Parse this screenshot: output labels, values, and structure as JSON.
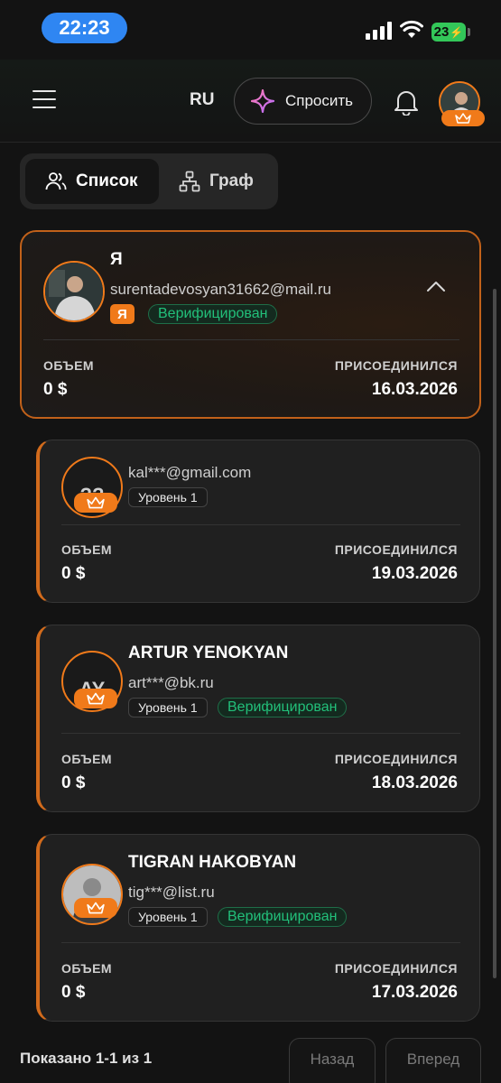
{
  "status_bar": {
    "time": "22:23",
    "battery": "23"
  },
  "header": {
    "lang": "RU",
    "ask_label": "Спросить"
  },
  "tabs": [
    {
      "label": "Список",
      "icon": "users-icon",
      "active": true
    },
    {
      "label": "Граф",
      "icon": "hierarchy-icon",
      "active": false
    }
  ],
  "me_card": {
    "name": "Я",
    "email": "surentadevosyan31662@mail.ru",
    "tag_me": "Я",
    "verified": "Верифицирован",
    "volume_label": "ОБЪЕМ",
    "volume": "0 $",
    "joined_label": "ПРИСОЕДИНИЛСЯ",
    "joined": "16.03.2026"
  },
  "referrals": [
    {
      "initials": "??",
      "name": "",
      "email": "kal***@gmail.com",
      "level": "Уровень 1",
      "verified": "",
      "volume_label": "ОБЪЕМ",
      "volume": "0 $",
      "joined_label": "ПРИСОЕДИНИЛСЯ",
      "joined": "19.03.2026"
    },
    {
      "initials": "AY",
      "name": "ARTUR YENOKYAN",
      "email": "art***@bk.ru",
      "level": "Уровень 1",
      "verified": "Верифицирован",
      "volume_label": "ОБЪЕМ",
      "volume": "0 $",
      "joined_label": "ПРИСОЕДИНИЛСЯ",
      "joined": "18.03.2026"
    },
    {
      "initials": "",
      "name": "TIGRAN HAKOBYAN",
      "email": "tig***@list.ru",
      "level": "Уровень 1",
      "verified": "Верифицирован",
      "volume_label": "ОБЪЕМ",
      "volume": "0 $",
      "joined_label": "ПРИСОЕДИНИЛСЯ",
      "joined": "17.03.2026"
    }
  ],
  "footer": {
    "summary": "Показано 1-1 из 1",
    "prev": "Назад",
    "next": "Вперед"
  },
  "colors": {
    "accent": "#f07a1a",
    "verified": "#22c07a",
    "background": "#131313"
  }
}
